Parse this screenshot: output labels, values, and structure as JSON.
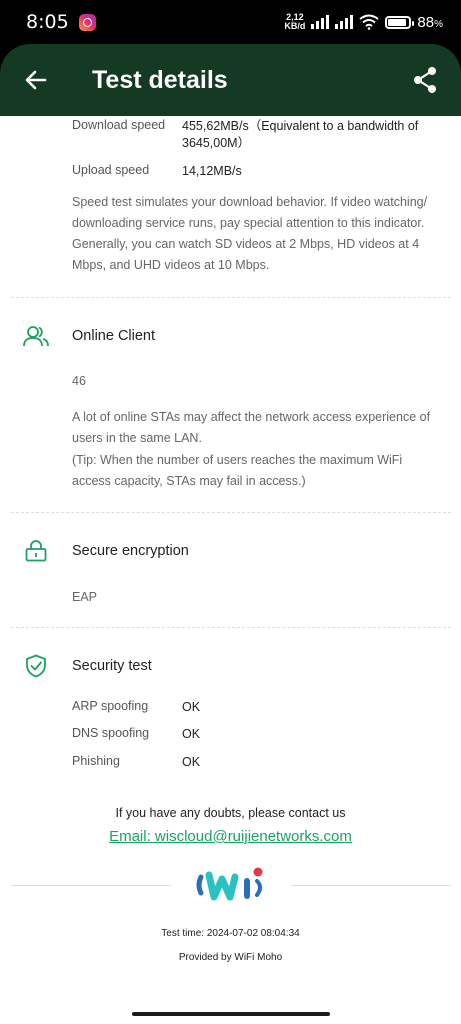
{
  "status": {
    "time": "8:05",
    "net_speed_value": "2,12",
    "net_speed_unit": "KB/d",
    "battery_percent": "88",
    "battery_symbol": "%"
  },
  "header": {
    "title": "Test details"
  },
  "speed": {
    "download_label": "Download speed",
    "download_value": "455,62MB/s（Equivalent to a bandwidth of 3645,00M）",
    "upload_label": "Upload speed",
    "upload_value": "14,12MB/s",
    "description": "Speed test simulates your download behavior. If video watching/ downloading service runs, pay special attention to this indicator. Generally, you can watch SD videos at 2 Mbps, HD videos at 4 Mbps, and UHD videos at 10 Mbps."
  },
  "online_client": {
    "title": "Online Client",
    "count": "46",
    "description": "A lot of online STAs may affect the network access experience of users in the same LAN.",
    "tip": "(Tip: When the number of users reaches the maximum WiFi access capacity, STAs may fail in access.)"
  },
  "encryption": {
    "title": "Secure encryption",
    "value": "EAP"
  },
  "security": {
    "title": "Security test",
    "items": [
      {
        "label": "ARP spoofing",
        "value": "OK"
      },
      {
        "label": "DNS spoofing",
        "value": "OK"
      },
      {
        "label": "Phishing",
        "value": "OK"
      }
    ]
  },
  "contact": {
    "text": "If you have any doubts, please contact us",
    "email": "Email: wiscloud@ruijienetworks.com"
  },
  "footer": {
    "test_time": "Test time: 2024-07-02 08:04:34",
    "provided_by": "Provided by WiFi Moho"
  },
  "colors": {
    "accent": "#1aa260",
    "header_bg": "#143a23",
    "logo_blue": "#2b6fb6",
    "logo_teal": "#29c1c2",
    "logo_red": "#e63946"
  }
}
